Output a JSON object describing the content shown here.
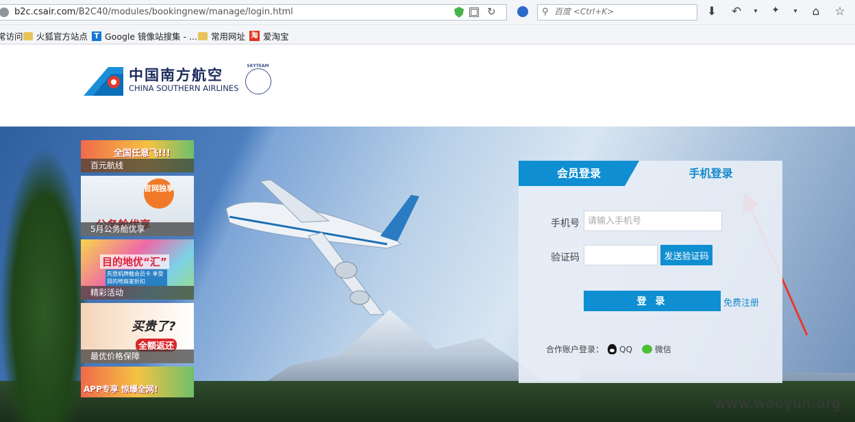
{
  "browser": {
    "url_host": "b2c.csair.com",
    "url_path": "/B2C40/modules/bookingnew/manage/login.html",
    "search_placeholder": "百度 <Ctrl+K>"
  },
  "bookmarks": [
    {
      "label": "常访问"
    },
    {
      "label": "火狐官方站点"
    },
    {
      "label": "Google 镜像站搜集 - ..."
    },
    {
      "label": "常用网址"
    },
    {
      "label": "爱淘宝"
    }
  ],
  "header": {
    "logo_cn": "中国南方航空",
    "logo_en": "CHINA SOUTHERN AIRLINES",
    "skyteam": "SKYTEAM"
  },
  "promos": [
    {
      "caption": "百元航线",
      "art_text": "全国任意飞!!!"
    },
    {
      "caption": "5月公务舱优享",
      "art_text": "公务舱优享",
      "badge": "官网独享"
    },
    {
      "caption": "精彩活动",
      "art_text": "目的地优“汇”",
      "sub": "先登机牌截会员卡 享受目的地商家折扣"
    },
    {
      "caption": "最优价格保障",
      "art_text": "买贵了?",
      "badge": "全额返还"
    },
    {
      "caption": "",
      "art_text": "APP专享 惊爆全网!"
    }
  ],
  "login": {
    "tab_member": "会员登录",
    "tab_phone": "手机登录",
    "phone_label": "手机号",
    "phone_placeholder": "请输入手机号",
    "phone_value": "",
    "code_label": "验证码",
    "code_value": "",
    "send_code": "发送验证码",
    "submit": "登 录",
    "register": "免费注册",
    "partner_label": "合作账户登录：",
    "qq": "QQ",
    "wechat": "微信"
  },
  "watermark": "www.wooyun.org",
  "colors": {
    "brand_blue": "#0f8fd1",
    "arrow_red": "#e8382e"
  }
}
